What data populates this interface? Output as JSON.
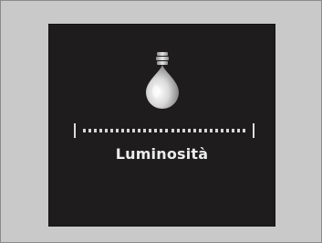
{
  "screen": {
    "icon": "light-bulb-icon",
    "label": "Luminosità",
    "brightness_level": 1.0,
    "segment_count": 30,
    "colors": {
      "outer_background": "#c9c9c9",
      "screen_background": "#1e1c1c",
      "bar": "#d6d6d6",
      "text": "#ececec"
    }
  }
}
